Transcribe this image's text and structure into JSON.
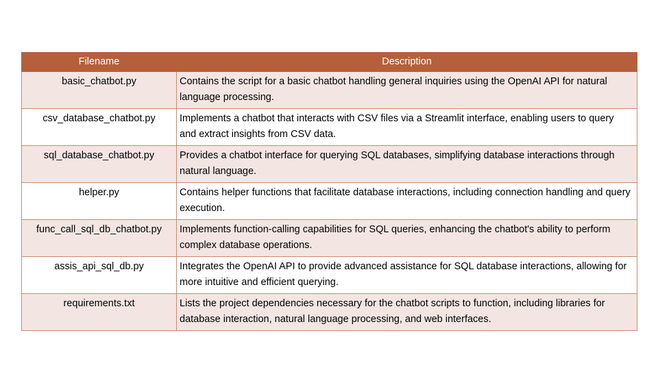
{
  "table": {
    "headers": {
      "filename": "Filename",
      "description": "Description"
    },
    "rows": [
      {
        "filename": "basic_chatbot.py",
        "description": "Contains the script for a basic chatbot handling general inquiries using the OpenAI API for natural language processing."
      },
      {
        "filename": "csv_database_chatbot.py",
        "description": "Implements a chatbot that interacts with CSV files via a Streamlit interface,  enabling users to query and extract insights from CSV data."
      },
      {
        "filename": "sql_database_chatbot.py",
        "description": "Provides a chatbot interface for querying SQL databases, simplifying database interactions through natural language."
      },
      {
        "filename": "helper.py",
        "description": "Contains helper functions that facilitate database interactions, including connection handling and query execution."
      },
      {
        "filename": "func_call_sql_db_chatbot.py",
        "description": "Implements function-calling capabilities for SQL queries, enhancing the chatbot's ability to perform complex database operations."
      },
      {
        "filename": "assis_api_sql_db.py",
        "description": "Integrates the OpenAI API to provide advanced assistance for SQL database interactions, allowing for more intuitive and efficient querying."
      },
      {
        "filename": "requirements.txt",
        "description": "Lists the project dependencies necessary for the chatbot scripts to function, including libraries for database interaction, natural language processing, and web interfaces."
      }
    ]
  },
  "colors": {
    "header_background": "#b5603a",
    "header_text": "#ffffff",
    "odd_row_background": "#f3e6e2",
    "even_row_background": "#ffffff",
    "border": "#c98a6e"
  }
}
